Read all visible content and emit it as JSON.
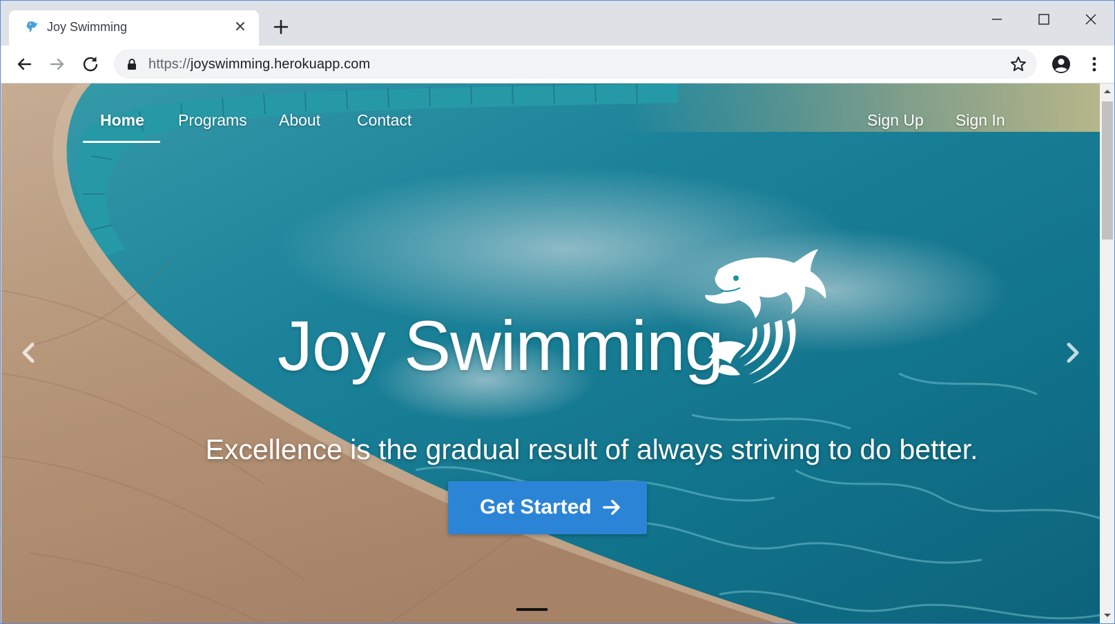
{
  "browser": {
    "tab_title": "Joy Swimming",
    "url_scheme": "https://",
    "url_host": "joyswimming.herokuapp.com",
    "icons": {
      "favicon": "dolphin-favicon",
      "close_tab": "close-icon",
      "new_tab": "plus-icon",
      "back": "back-arrow-icon",
      "forward": "forward-arrow-icon",
      "reload": "reload-icon",
      "secure": "lock-icon",
      "bookmark": "star-icon",
      "profile": "account-icon",
      "menu": "kebab-menu-icon",
      "minimize": "minimize-icon",
      "maximize": "maximize-icon",
      "close_window": "close-icon"
    }
  },
  "nav": {
    "left": [
      "Home",
      "Programs",
      "About",
      "Contact"
    ],
    "right": [
      "Sign Up",
      "Sign In"
    ],
    "active": "Home"
  },
  "hero": {
    "title": "Joy Swimming",
    "tagline": "Excellence is the gradual result of always striving to do better.",
    "cta_label": "Get Started",
    "cta_color": "#2b84d6",
    "logo_icon": "dolphin-logo-icon",
    "carousel": {
      "slides": 2,
      "active_slide": 1
    }
  },
  "colors": {
    "water": "#1f8fa8",
    "deck": "#c9a98a",
    "nav_text": "#ffffff"
  }
}
